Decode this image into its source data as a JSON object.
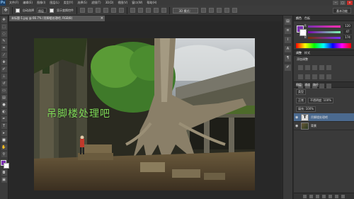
{
  "app": {
    "logo": "Ps"
  },
  "menubar": {
    "items": [
      "文件(F)",
      "编辑(E)",
      "图像(I)",
      "图层(L)",
      "类型(Y)",
      "选择(S)",
      "滤镜(T)",
      "3D(D)",
      "视图(V)",
      "窗口(W)",
      "帮助(H)"
    ],
    "window_controls": [
      "−",
      "□",
      "✕"
    ]
  },
  "options": {
    "auto_select_label": "自动选择",
    "auto_select_target": "图层",
    "show_transform_label": "显示变换控件",
    "mode_3d_label": "3D 模式：",
    "workspace": "基本功能"
  },
  "document": {
    "tab_title": "未标题-1.jpg @ 66.7% (吊脚楼处理吧, RGB/8)",
    "overlay_text": "吊脚楼处理吧"
  },
  "panels": {
    "color_tabs": [
      "颜色",
      "色板"
    ],
    "sliders": [
      {
        "label": "R",
        "value": "120",
        "color": "#d04040"
      },
      {
        "label": "G",
        "value": "47",
        "color": "#40b040"
      },
      {
        "label": "B",
        "value": "174",
        "color": "#4060d0"
      }
    ],
    "adjust_tabs": [
      "调整",
      "样式"
    ],
    "adjust_title": "添加调整",
    "layers_tabs": [
      "图层",
      "通道",
      "路径"
    ],
    "kind_label": "类型",
    "blend_mode": "正常",
    "opacity_label": "不透明度: 100%",
    "fill_label": "填充: 100%",
    "layers": [
      {
        "name": "吊脚楼处理吧",
        "type": "text",
        "active": true
      },
      {
        "name": "背景",
        "type": "image",
        "active": false
      }
    ]
  },
  "colors": {
    "foreground": "#7a2fb0",
    "background": "#ffffff",
    "overlay_text": "#7ed957",
    "active_layer": "#4b6a8f"
  }
}
